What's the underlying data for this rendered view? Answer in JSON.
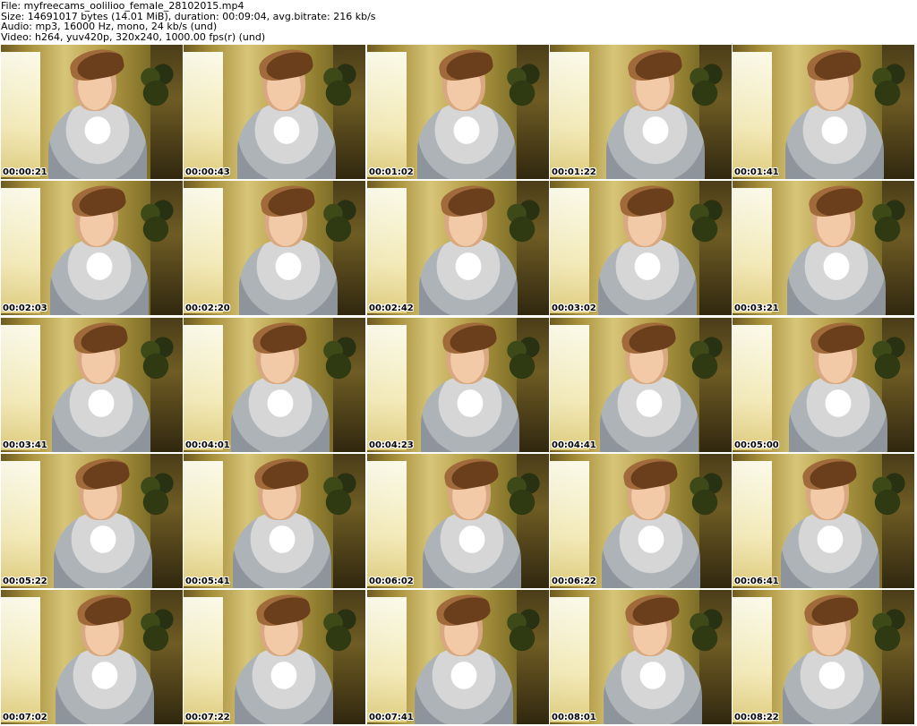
{
  "header": {
    "file": "File: myfreecams_oolilioo_female_28102015.mp4",
    "size": "Size: 14691017 bytes (14.01 MiB), duration: 00:09:04, avg.bitrate: 216 kb/s",
    "audio": "Audio: mp3, 16000 Hz, mono, 24 kb/s (und)",
    "video": "Video: h264, yuv420p, 320x240, 1000.00 fps(r) (und)"
  },
  "thumbnails": [
    {
      "time": "00:00:21"
    },
    {
      "time": "00:00:43"
    },
    {
      "time": "00:01:02"
    },
    {
      "time": "00:01:22"
    },
    {
      "time": "00:01:41"
    },
    {
      "time": "00:02:03"
    },
    {
      "time": "00:02:20"
    },
    {
      "time": "00:02:42"
    },
    {
      "time": "00:03:02"
    },
    {
      "time": "00:03:21"
    },
    {
      "time": "00:03:41"
    },
    {
      "time": "00:04:01"
    },
    {
      "time": "00:04:23"
    },
    {
      "time": "00:04:41"
    },
    {
      "time": "00:05:00"
    },
    {
      "time": "00:05:22"
    },
    {
      "time": "00:05:41"
    },
    {
      "time": "00:06:02"
    },
    {
      "time": "00:06:22"
    },
    {
      "time": "00:06:41"
    },
    {
      "time": "00:07:02"
    },
    {
      "time": "00:07:22"
    },
    {
      "time": "00:07:41"
    },
    {
      "time": "00:08:01"
    },
    {
      "time": "00:08:22"
    }
  ]
}
